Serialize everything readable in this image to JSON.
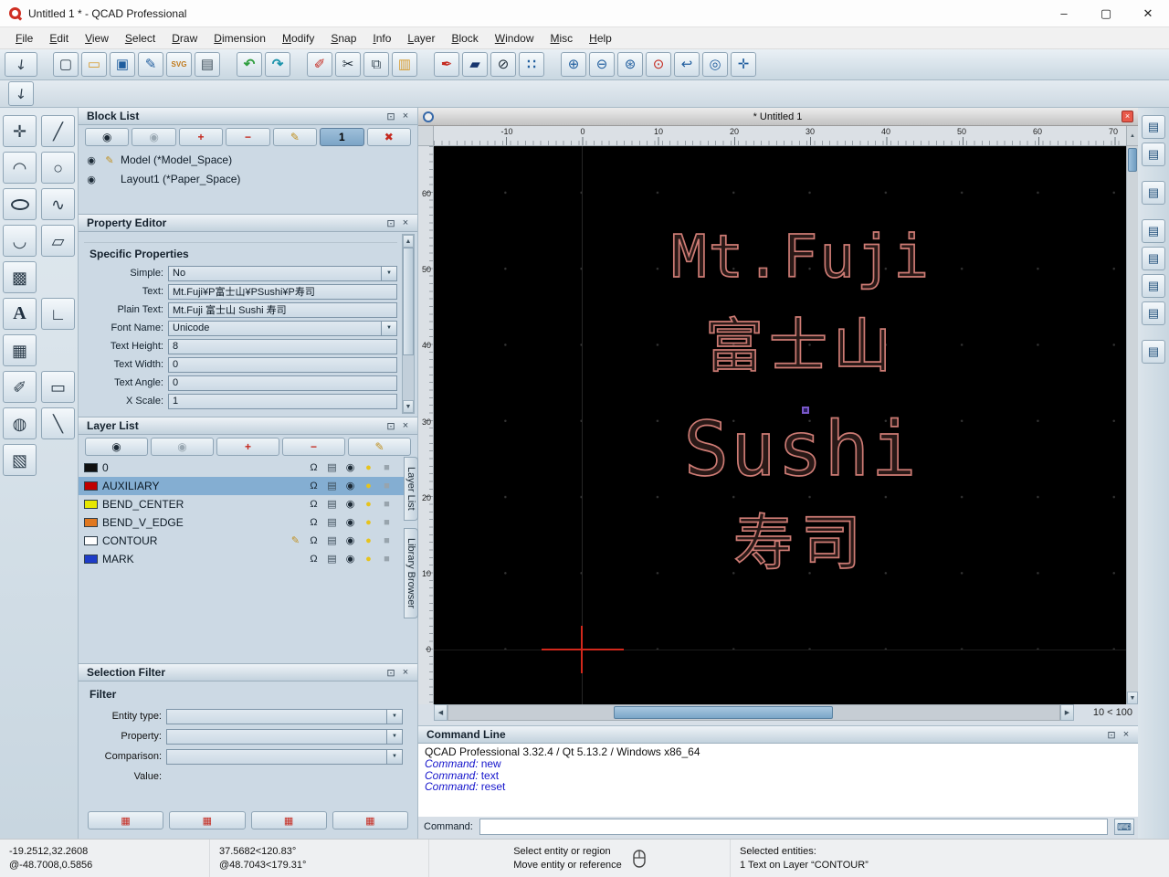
{
  "window": {
    "title": "Untitled 1 * - QCAD Professional"
  },
  "window_controls": {
    "minimize": "–",
    "maximize": "▢",
    "close": "✕"
  },
  "menubar": [
    "File",
    "Edit",
    "View",
    "Select",
    "Draw",
    "Dimension",
    "Modify",
    "Snap",
    "Info",
    "Layer",
    "Block",
    "Window",
    "Misc",
    "Help"
  ],
  "toolbar": {
    "svg_label": "SVG"
  },
  "icons": {
    "pointer": "↖",
    "new": "▢",
    "open": "▭",
    "save": "▣",
    "save_as": "✎",
    "print": "▤",
    "undo": "↶",
    "redo": "↷",
    "erase": "✐",
    "cut": "✂",
    "copy": "⧉",
    "paste": "▥",
    "pen": "✒",
    "polyline": "▰",
    "ellipse": "⊘",
    "grid": "∷",
    "zoom_in": "⊕",
    "zoom_out": "⊖",
    "zoom_auto": "⊛",
    "zoom_sel": "⊙",
    "zoom_prev": "↩",
    "zoom_win": "◎",
    "pan": "✛",
    "eye": "◉",
    "add": "+",
    "remove": "−",
    "edit": "✎",
    "delete": "✖",
    "float": "⊡",
    "close": "×",
    "bell": "Ω",
    "printer": "▤",
    "sun": "●",
    "lock": "■",
    "combo": "▼",
    "up": "▲",
    "down": "▼",
    "left": "◀",
    "right": "▶",
    "keyboard": "⌨",
    "panel": "▤",
    "filter_btn": "▦",
    "tool_point": "✛",
    "tool_line": "╱",
    "tool_arc": "◠",
    "tool_circle": "○",
    "tool_spline": "∿",
    "tool_polyline": "◡",
    "tool_shape": "▱",
    "tool_hatch": "▩",
    "tool_text": "A",
    "tool_ortho": "∟",
    "tool_image": "▦",
    "tool_measure": "✐",
    "tool_ruler": "▭",
    "tool_circle2": "◍",
    "tool_tangent": "╲",
    "tool_box": "▧"
  },
  "block_list": {
    "title": "Block List",
    "toggle_label": "1",
    "rows": [
      {
        "label": "Model (*Model_Space)"
      },
      {
        "label": "Layout1 (*Paper_Space)"
      }
    ]
  },
  "property_editor": {
    "title": "Property Editor",
    "section": "Specific Properties",
    "rows": [
      {
        "label": "Simple:",
        "value": "No"
      },
      {
        "label": "Text:",
        "value": "Mt.Fuji¥P富士山¥PSushi¥P寿司"
      },
      {
        "label": "Plain Text:",
        "value": "Mt.Fuji 富士山 Sushi 寿司"
      },
      {
        "label": "Font Name:",
        "value": "Unicode"
      },
      {
        "label": "Text Height:",
        "value": "8"
      },
      {
        "label": "Text Width:",
        "value": "0"
      },
      {
        "label": "Text Angle:",
        "value": "0"
      },
      {
        "label": "X Scale:",
        "value": "1"
      }
    ]
  },
  "layer_list": {
    "title": "Layer List",
    "layers": [
      {
        "name": "0",
        "color": "#101010"
      },
      {
        "name": "AUXILIARY",
        "color": "#c00000"
      },
      {
        "name": "BEND_CENTER",
        "color": "#e6e600"
      },
      {
        "name": "BEND_V_EDGE",
        "color": "#e07820"
      },
      {
        "name": "CONTOUR",
        "color": "#ffffff"
      },
      {
        "name": "MARK",
        "color": "#1e3cc8"
      }
    ]
  },
  "dock_tabs": {
    "layer_list": "Layer List",
    "library_browser": "Library Browser"
  },
  "selection_filter": {
    "title": "Selection Filter",
    "section": "Filter",
    "fields": [
      {
        "label": "Entity type:"
      },
      {
        "label": "Property:"
      },
      {
        "label": "Comparison:"
      },
      {
        "label": "Value:"
      }
    ]
  },
  "document": {
    "tab_title": "* Untitled 1",
    "ruler_h": [
      "-10",
      "0",
      "10",
      "20",
      "30",
      "40",
      "50",
      "60",
      "70"
    ],
    "ruler_v": [
      "60",
      "50",
      "40",
      "30",
      "20",
      "10",
      "0"
    ],
    "texts": [
      {
        "text": "Mt.Fuji"
      },
      {
        "text": "富士山"
      },
      {
        "text": "Sushi"
      },
      {
        "text": "寿司"
      }
    ],
    "grid_info": "10 < 100"
  },
  "command_line": {
    "title": "Command Line",
    "version_line": "QCAD Professional 3.32.4 / Qt 5.13.2 / Windows x86_64",
    "prefix": "Command:",
    "commands": [
      "new",
      "text",
      "reset"
    ],
    "input_label": "Command:",
    "input_value": ""
  },
  "statusbar": {
    "abs_xy": "-19.2512,32.2608",
    "rel_xy": "@-48.7008,0.5856",
    "abs_polar": "37.5682<120.83°",
    "rel_polar": "@48.7043<179.31°",
    "hint_primary": "Select entity or region",
    "hint_secondary": "Move entity or reference",
    "selected_label": "Selected entities:",
    "selected_value": "1 Text on Layer “CONTOUR”"
  },
  "colors": {
    "canvas_bg": "#000000",
    "cad_text": "#cd7b74",
    "command_text": "#1515cc",
    "selected_row": "#84aed2",
    "crosshair": "#d2281c"
  }
}
